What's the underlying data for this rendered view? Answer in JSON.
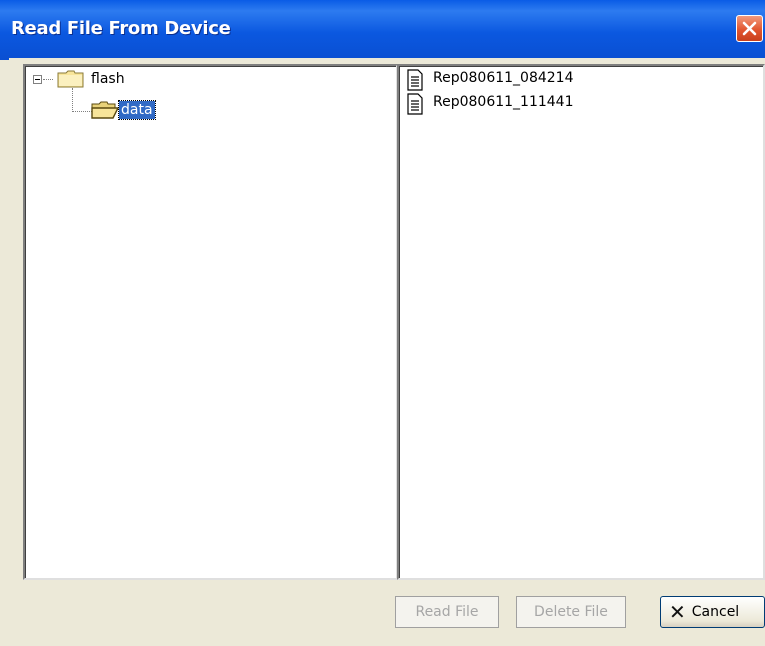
{
  "window": {
    "title": "Read File From Device"
  },
  "tree": {
    "items": [
      {
        "label": "flash",
        "expanded": true,
        "icon": "folder-closed-icon"
      },
      {
        "label": "data",
        "selected": true,
        "icon": "folder-open-icon"
      }
    ]
  },
  "files": {
    "items": [
      {
        "name": "Rep080611_084214",
        "icon": "document-icon"
      },
      {
        "name": "Rep080611_111441",
        "icon": "document-icon"
      }
    ]
  },
  "buttons": {
    "read_file": "Read File",
    "delete_file": "Delete File",
    "cancel": "Cancel"
  },
  "colors": {
    "titlebar": "#0a5ce6",
    "selection": "#316ac5",
    "close": "#e2562f",
    "dialog": "#ece9d8"
  }
}
